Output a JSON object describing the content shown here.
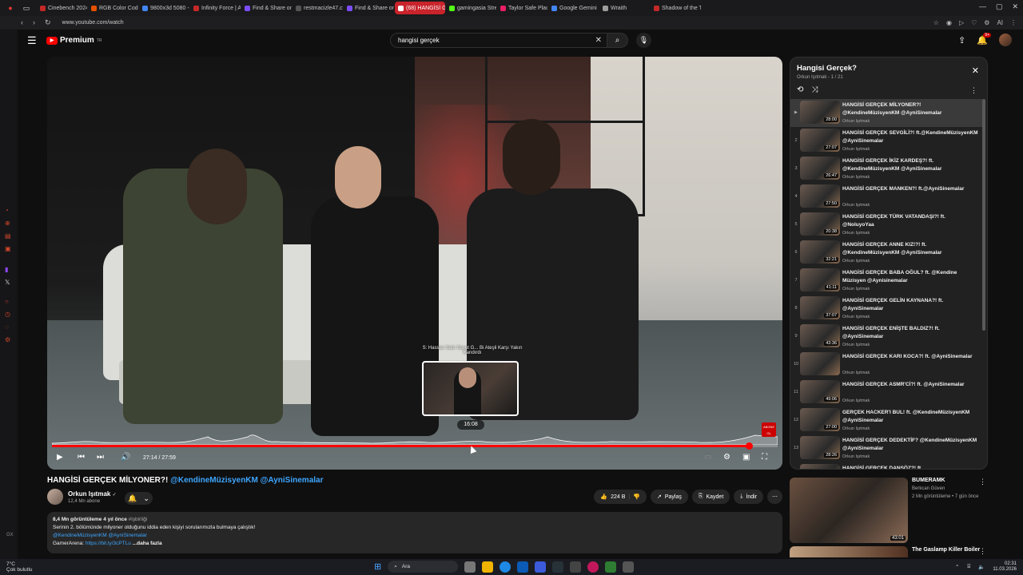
{
  "browser": {
    "tabs": [
      {
        "label": "Cinebench 2024 Down",
        "color": "#c62828"
      },
      {
        "label": "RGB Color Codes Cha",
        "color": "#e65100"
      },
      {
        "label": "9800x3d 5080 - Goog",
        "color": "#4285f4"
      },
      {
        "label": "Infinity Force | AMD R",
        "color": "#c62828"
      },
      {
        "label": "Find & Share on GIPH",
        "color": "#7c4dff"
      },
      {
        "label": "restmacizle47.cfd",
        "color": "#555555"
      },
      {
        "label": "Find & Share on GIPH",
        "color": "#7c4dff"
      },
      {
        "label": "(68) HANGİSİ GERÇEK M",
        "color": "#ffffff",
        "active": true
      },
      {
        "label": "gamingasia Stream - V",
        "color": "#53fc18"
      },
      {
        "label": "Taylor Safe Place",
        "color": "#e91e63"
      },
      {
        "label": "Google Gemini",
        "color": "#4285f4"
      },
      {
        "label": "Wraith",
        "color": "#9e9e9e"
      },
      {
        "label": "Shadow of the Tomb R",
        "color": "#c62828"
      }
    ],
    "url": "www.youtube.com/watch",
    "ai_label": "AI"
  },
  "header": {
    "logo_text": "Premium",
    "logo_sup": "TR",
    "search_value": "hangisi gerçek",
    "notification_count": "9+"
  },
  "player": {
    "preview_title": "S: Hassas Sattı Soyut G... Bi Ateşli Karşı Yakın",
    "preview_sub": "Kandırdı",
    "preview_time": "16:08",
    "current_time": "27:14 / 27:59",
    "progress_fraction": 0.96,
    "subscribe_mini": "ABONE OL"
  },
  "video": {
    "title": "HANGİSİ GERÇEK MİLYONER?!",
    "title_mentions": "@KendineMüzisyenKM @AyniSinemalar",
    "channel": "Orkun Işıtmak",
    "verified": "✓",
    "subscribers": "12,4 Mn abone",
    "likes": "224 B",
    "share": "Paylaş",
    "save": "Kaydet",
    "download": "İndir"
  },
  "description": {
    "views": "8,4 Mn görüntüleme",
    "age": "4 yıl önce",
    "tag": "#işbirliği",
    "line1": "Serinin 2. bölümünde milyoner olduğunu iddia eden kişiyi sorularımızla bulmaya çalıştık!",
    "line2": "@KendineMüzisyenKM @AyniSinemalar",
    "line3_prefix": "GamerArena:",
    "line3_link": "https://bit.ly/3cPTLu",
    "more": "...daha fazla"
  },
  "playlist": {
    "title": "Hangisi Gerçek?",
    "subtitle": "Orkun Işıtmak - 1 / 21",
    "items": [
      {
        "idx": "▶",
        "title": "HANGİSİ GERÇEK MİLYONER?! @KendineMüzisyenKM @AyniSinemalar",
        "channel": "Orkun Işıtmak",
        "duration": "28:00",
        "active": true
      },
      {
        "idx": "2",
        "title": "HANGİSİ GERÇEK SEVGİLİ?! ft.@KendineMüzisyenKM @AyniSinemalar",
        "channel": "Orkun Işıtmak",
        "duration": "27:07"
      },
      {
        "idx": "3",
        "title": "HANGİSİ GERÇEK İKİZ KARDEŞ?! ft. @KendineMüzisyenKM @AyniSinemalar",
        "channel": "Orkun Işıtmak",
        "duration": "26:47"
      },
      {
        "idx": "4",
        "title": "HANGİSİ GERÇEK MANKEN?! ft.@AyniSinemalar",
        "channel": "Orkun Işıtmak",
        "duration": "27:50"
      },
      {
        "idx": "5",
        "title": "HANGİSİ GERÇEK TÜRK VATANDAŞI?! ft. @NoluyoYaa",
        "channel": "Orkun Işıtmak",
        "duration": "20:38"
      },
      {
        "idx": "6",
        "title": "HANGİSİ GERÇEK ANNE KIZ!?! ft. @KendineMüzisyenKM @AyniSinemalar",
        "channel": "Orkun Işıtmak",
        "duration": "32:21"
      },
      {
        "idx": "7",
        "title": "HANGİSİ GERÇEK BABA OĞUL? ft. @Kendine Müzisyen @Aynisinemalar",
        "channel": "Orkun Işıtmak",
        "duration": "41:11"
      },
      {
        "idx": "8",
        "title": "HANGİSİ GERÇEK GELİN KAYNANA?! ft. @AyniSinemalar",
        "channel": "Orkun Işıtmak",
        "duration": "37:07"
      },
      {
        "idx": "9",
        "title": "HANGİSİ GERÇEK ENİŞTE BALDIZ?! ft. @AyniSinemalar",
        "channel": "Orkun Işıtmak",
        "duration": "43:36"
      },
      {
        "idx": "10",
        "title": "HANGİSİ GERÇEK KARI KOCA?! ft. @AyniSinemalar",
        "channel": "Orkun Işıtmak",
        "duration": ""
      },
      {
        "idx": "11",
        "title": "HANGİSİ GERÇEK ASMR'Cİ?! ft. @AyniSinemalar",
        "channel": "Orkun Işıtmak",
        "duration": "49:06"
      },
      {
        "idx": "12",
        "title": "GERÇEK HACKER'I BUL! ft. @KendineMüzisyenKM @AyniSinemalar",
        "channel": "Orkun Işıtmak",
        "duration": "27:00"
      },
      {
        "idx": "13",
        "title": "HANGİSİ GERÇEK DEDEKTİF? @KendineMüzisyenKM @AyniSinemalar",
        "channel": "Orkun Işıtmak",
        "duration": "28:26"
      },
      {
        "idx": "14",
        "title": "HANGİSİ GERÇEK DANSÖZ?! ft.",
        "channel": "",
        "duration": ""
      }
    ]
  },
  "recommendations": [
    {
      "title": "BUMERAMK",
      "channel": "Berkcan Güven",
      "meta": "2 Mn görüntüleme • 7 gün önce",
      "duration": "43:01"
    },
    {
      "title": "The Gaslamp Killer Boiler",
      "channel": "",
      "meta": "",
      "duration": ""
    }
  ],
  "taskbar": {
    "temp": "7°C",
    "weather": "Çok bulutlu",
    "search": "Ara",
    "time": "02:31",
    "date": "11.03.2026"
  },
  "colors": {
    "accent": "#ff0000",
    "link": "#3ea6ff"
  }
}
